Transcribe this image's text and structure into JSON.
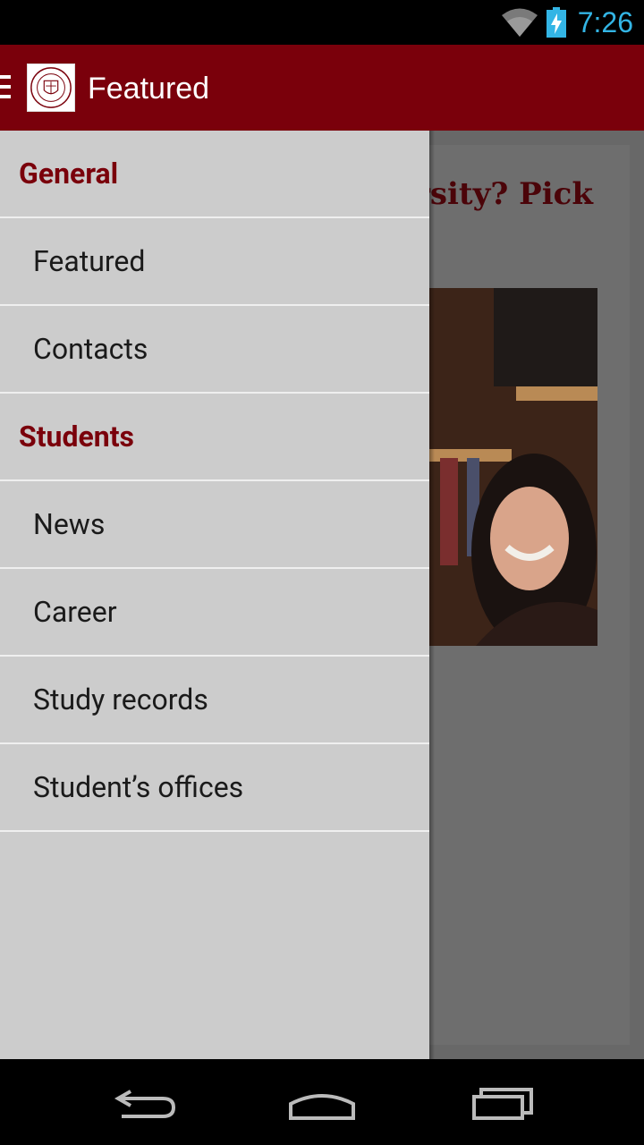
{
  "status_bar": {
    "time": "7:26",
    "icons": [
      "wifi-icon",
      "battery-charging-icon"
    ],
    "time_color": "#33b5e5"
  },
  "action_bar": {
    "title": "Featured",
    "background": "#7a000b",
    "logo": "university-seal-logo"
  },
  "content": {
    "headline": "What to study at university? Pick your course!"
  },
  "drawer": {
    "sections": [
      {
        "header": "General",
        "items": [
          {
            "label": "Featured"
          },
          {
            "label": "Contacts"
          }
        ]
      },
      {
        "header": "Students",
        "items": [
          {
            "label": "News"
          },
          {
            "label": "Career"
          },
          {
            "label": "Study records"
          },
          {
            "label": "Student’s offices"
          }
        ]
      }
    ],
    "header_color": "#7a000b"
  },
  "navigation_bar": {
    "buttons": [
      "back-icon",
      "home-icon",
      "recents-icon"
    ]
  }
}
